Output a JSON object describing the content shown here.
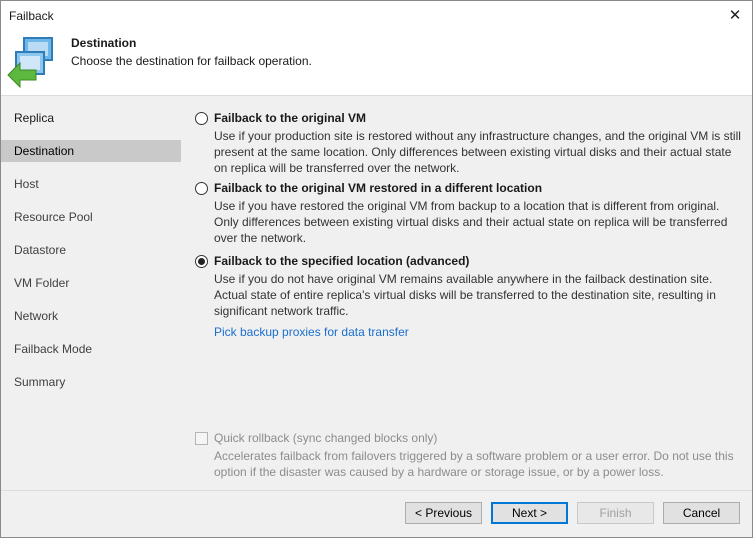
{
  "window": {
    "title": "Failback",
    "close_glyph": "✕"
  },
  "header": {
    "title": "Destination",
    "subtitle": "Choose the destination for failback operation.",
    "logo_icon": "vm-failback-icon"
  },
  "sidebar": {
    "items": [
      {
        "label": "Replica",
        "state": "done"
      },
      {
        "label": "Destination",
        "state": "active"
      },
      {
        "label": "Host",
        "state": "pending"
      },
      {
        "label": "Resource Pool",
        "state": "pending"
      },
      {
        "label": "Datastore",
        "state": "pending"
      },
      {
        "label": "VM Folder",
        "state": "pending"
      },
      {
        "label": "Network",
        "state": "pending"
      },
      {
        "label": "Failback Mode",
        "state": "pending"
      },
      {
        "label": "Summary",
        "state": "pending"
      }
    ]
  },
  "options": [
    {
      "label": "Failback to the original VM",
      "description": "Use if your production site is restored without any infrastructure changes, and the original VM is still present at the same location. Only differences between existing virtual disks and their actual state on replica will be transferred over the network.",
      "selected": false
    },
    {
      "label": "Failback to the original VM restored in a different location",
      "description": "Use if you have restored the original VM from backup to a location that is different from original. Only differences between existing virtual disks and their actual state on replica will be transferred over the network.",
      "selected": false
    },
    {
      "label": "Failback to the specified location (advanced)",
      "description": "Use if you do not have original VM remains available anywhere in the failback destination site. Actual state of entire replica's virtual disks will be transferred to the destination site, resulting in significant network traffic.",
      "selected": true
    }
  ],
  "proxies_link": "Pick backup proxies for data transfer",
  "quick_rollback": {
    "label": "Quick rollback (sync changed blocks only)",
    "description": "Accelerates failback from failovers triggered by a software problem or a user error. Do not use this option if the disaster was caused by a hardware or storage issue, or by a power loss.",
    "checked": false,
    "enabled": false
  },
  "buttons": {
    "previous": "< Previous",
    "next": "Next >",
    "finish": "Finish",
    "cancel": "Cancel"
  },
  "colors": {
    "accent": "#0078d7",
    "link": "#1a6fcf",
    "active_step": "#c9c9c9"
  }
}
